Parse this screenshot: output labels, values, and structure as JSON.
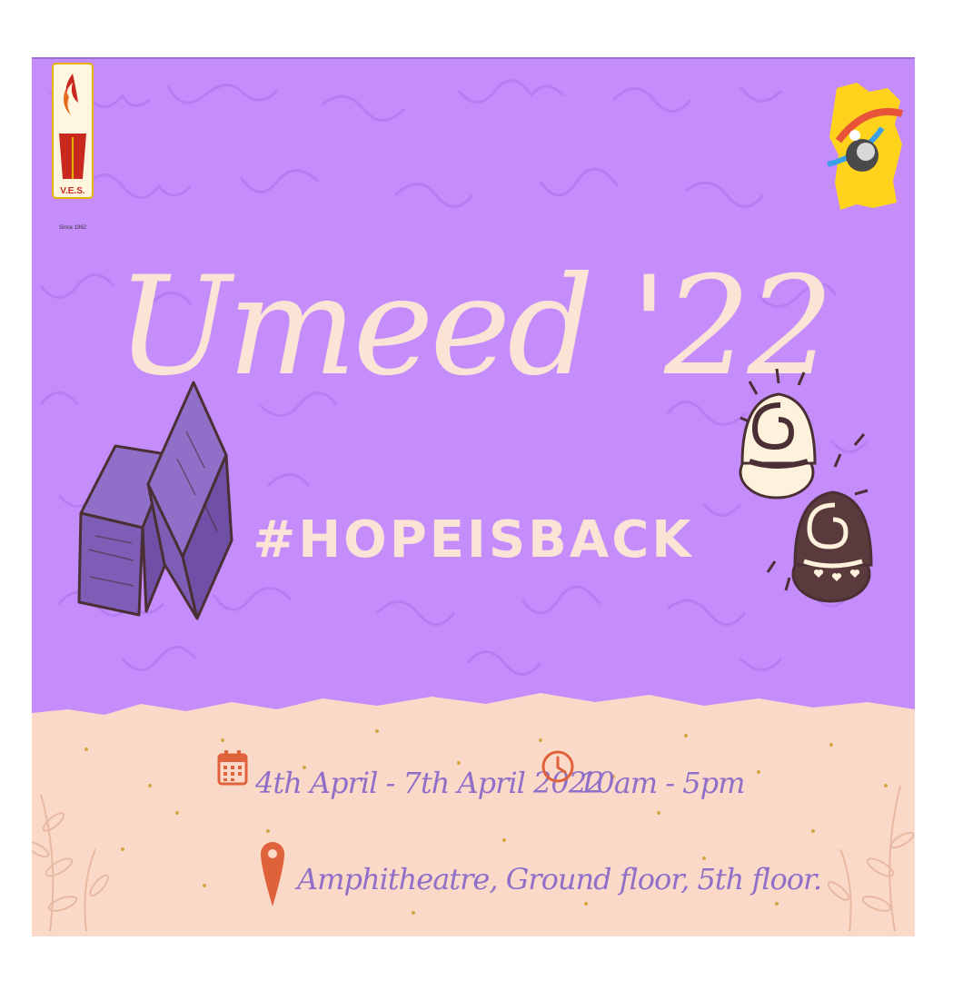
{
  "logos": {
    "left": {
      "text": "V.E.S.",
      "subtext": "Since 1962"
    }
  },
  "event": {
    "title": "Umeed '22",
    "hashtag": "#HOPEISBACK",
    "date": "4th April - 7th April 2022",
    "time": "10am - 5pm",
    "venue": "Amphitheatre, Ground floor, 5th floor."
  },
  "icons": [
    "calendar-icon",
    "clock-icon",
    "location-pin-icon",
    "brownie-illustration",
    "chocolate-truffle-illustration",
    "leaf-illustration"
  ],
  "colors": {
    "background_purple": "#c58cfb",
    "cream": "#fbe3d6",
    "paper": "#fbd9c8",
    "accent_orange": "#e0623a",
    "text_purple": "#8f6fc8",
    "brown": "#5a3a3d"
  }
}
